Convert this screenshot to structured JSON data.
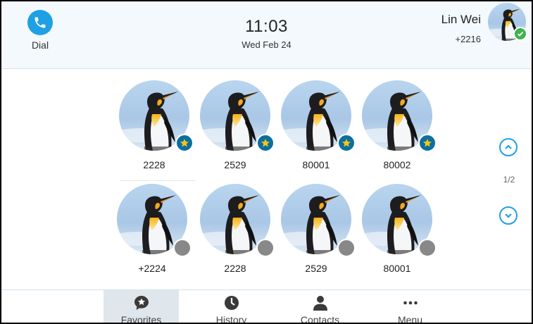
{
  "header": {
    "dial_label": "Dial",
    "time": "11:03",
    "date": "Wed Feb 24",
    "account_name": "Lin Wei",
    "account_number": "+2216",
    "account_status": "online"
  },
  "favorites": [
    {
      "label": "2228",
      "badge": "star"
    },
    {
      "label": "2529",
      "badge": "star"
    },
    {
      "label": "80001",
      "badge": "star"
    },
    {
      "label": "80002",
      "badge": "star"
    },
    {
      "label": "+2224",
      "badge": "offline"
    },
    {
      "label": "2228",
      "badge": "offline"
    },
    {
      "label": "2529",
      "badge": "offline"
    },
    {
      "label": "80001",
      "badge": "offline"
    }
  ],
  "pager": {
    "indicator": "1/2"
  },
  "nav": {
    "items": [
      {
        "label": "Favorites",
        "icon": "favorites-star-bubble-icon",
        "active": true
      },
      {
        "label": "History",
        "icon": "clock-icon",
        "active": false
      },
      {
        "label": "Contacts",
        "icon": "person-icon",
        "active": false
      },
      {
        "label": "Menu",
        "icon": "more-dots-icon",
        "active": false
      }
    ]
  },
  "colors": {
    "accent": "#1fa0e4",
    "header_bg": "#f3f9fd",
    "favorite_badge": "#0c6f9f",
    "star": "#f5c518",
    "online": "#3bb54a",
    "offline": "#888888",
    "active_tab_bg": "#dfe6ec"
  }
}
